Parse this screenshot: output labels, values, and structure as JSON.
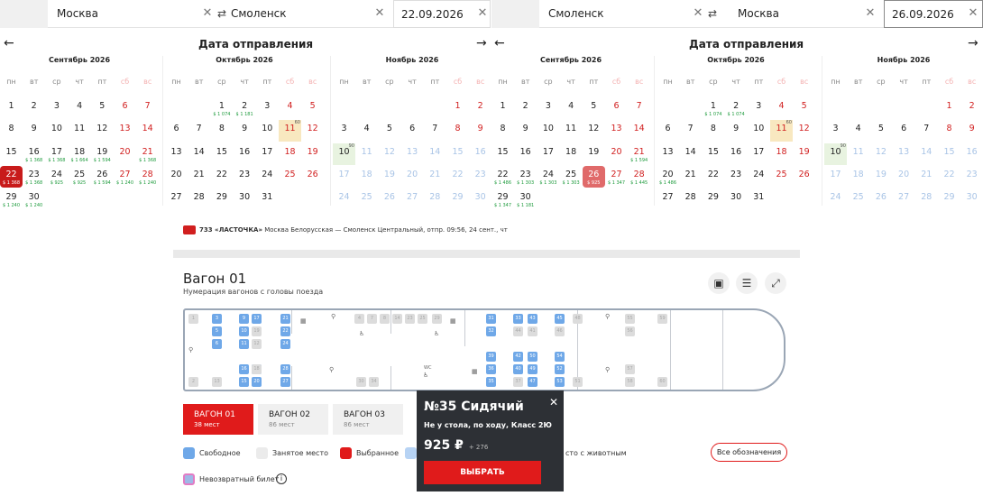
{
  "search_left": {
    "from": "Москва",
    "to": "Смоленск",
    "date": "22.09.2026"
  },
  "search_right": {
    "from": "Смоленск",
    "to": "Москва",
    "date": "26.09.2026"
  },
  "calendar_title": "Дата отправления",
  "weekdays": [
    "пн",
    "вт",
    "ср",
    "чт",
    "пт",
    "сб",
    "вс"
  ],
  "left_months": [
    {
      "name": "Сентябрь 2026",
      "start": 1,
      "days": 30,
      "prices": {
        "21": "1 368",
        "22": "1 368",
        "23": "1 368",
        "24": "925",
        "25": "925",
        "26": "1 594",
        "27": "1 240",
        "28": "1 240",
        "29": "1 240",
        "30": "1 240",
        "16": "1 368",
        "17": "1 368",
        "18": "1 664",
        "19": "1 594"
      },
      "selected": 22
    },
    {
      "name": "Октябрь 2026",
      "start": 3,
      "days": 31,
      "prices": {
        "1": "1 074",
        "2": "1 181"
      },
      "tags": {
        "11": "60"
      }
    },
    {
      "name": "Ноябрь 2026",
      "start": 6,
      "days": 30,
      "disabled_from": 11,
      "tags": {
        "10": "90"
      }
    }
  ],
  "right_months": [
    {
      "name": "Сентябрь 2026",
      "start": 1,
      "days": 30,
      "prices": {
        "21": "1 594",
        "22": "1 486",
        "23": "1 303",
        "24": "1 303",
        "25": "1 303",
        "26": "925",
        "27": "1 347",
        "28": "1 445",
        "29": "1 347",
        "30": "1 181"
      },
      "selected": 26
    },
    {
      "name": "Октябрь 2026",
      "start": 3,
      "days": 31,
      "prices": {
        "1": "1 074",
        "2": "1 074",
        "20": "1 486"
      },
      "tags": {
        "11": "60"
      }
    },
    {
      "name": "Ноябрь 2026",
      "start": 6,
      "days": 30,
      "disabled_from": 11,
      "tags": {
        "10": "90"
      }
    }
  ],
  "train": {
    "number": "733 «ЛАСТОЧКА»",
    "route": "Москва Белорусская — Смоленск Центральный, отпр. 09:56, 24 сент., чт"
  },
  "car": {
    "title": "Вагон 01",
    "subtitle": "Нумерация вагонов с головы поезда"
  },
  "tabs": [
    {
      "label": "ВАГОН 01",
      "seats": "38 мест"
    },
    {
      "label": "ВАГОН 02",
      "seats": "86 мест"
    },
    {
      "label": "ВАГОН 03",
      "seats": "86 мест"
    }
  ],
  "legend": {
    "free": "Свободное",
    "taken": "Занятое место",
    "selected": "Выбранное",
    "pets": "сто с животным",
    "nonrefund": "Невозвратный билет",
    "all": "Все обозначения"
  },
  "popup": {
    "title": "№35 Сидячий",
    "desc": "Не у стола, по ходу, Класс 2Ю",
    "price": "925 ₽",
    "fee": "+ 276",
    "button": "ВЫБРАТЬ"
  },
  "wc": "WC",
  "free_seats": [
    "3",
    "9",
    "17",
    "21",
    "5",
    "10",
    "22",
    "6",
    "11",
    "20",
    "24",
    "31",
    "32",
    "33",
    "43",
    "45",
    "35",
    "36",
    "42",
    "50",
    "54",
    "40",
    "49",
    "52",
    "39",
    "47",
    "53",
    "16",
    "26",
    "28",
    "15",
    "27"
  ],
  "occupied_seats": [
    "1",
    "2",
    "7",
    "4",
    "8",
    "12",
    "14",
    "13",
    "18",
    "19",
    "23",
    "25",
    "29",
    "30",
    "34",
    "37",
    "38",
    "41",
    "44",
    "46",
    "48",
    "51",
    "55",
    "56",
    "57",
    "58",
    "59",
    "60"
  ]
}
